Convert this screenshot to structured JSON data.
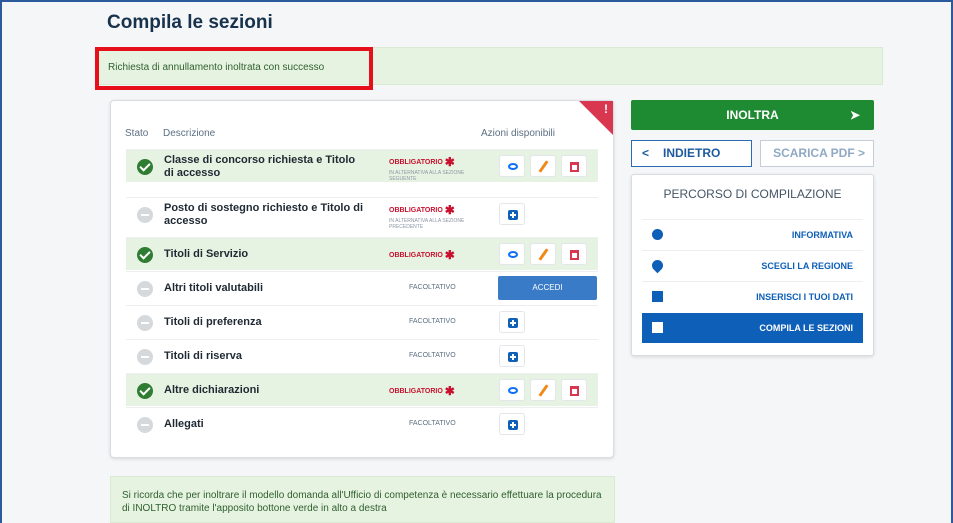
{
  "page": {
    "title": "Compila le sezioni"
  },
  "alert": {
    "success": "Richiesta di annullamento inoltrata con successo"
  },
  "table": {
    "headers": {
      "stato": "Stato",
      "descrizione": "Descrizione",
      "azioni": "Azioni disponibili"
    },
    "corner_mark": "!",
    "rows": [
      {
        "title": "Classe di concorso richiesta e Titolo di accesso",
        "status": "completed",
        "requirement": "OBBLIGATORIO",
        "note": "IN ALTERNATIVA ALLA SEZIONE SEGUENTE",
        "actions": [
          "view",
          "edit",
          "delete"
        ]
      },
      {
        "title": "Posto di sostegno richiesto e Titolo di accesso",
        "status": "empty",
        "requirement": "OBBLIGATORIO",
        "note": "IN ALTERNATIVA ALLA SEZIONE PRECEDENTE",
        "actions": [
          "add"
        ]
      },
      {
        "title": "Titoli di Servizio",
        "status": "completed",
        "requirement": "OBBLIGATORIO",
        "actions": [
          "view",
          "edit",
          "delete"
        ]
      },
      {
        "title": "Altri titoli valutabili",
        "status": "empty",
        "requirement": "FACOLTATIVO",
        "actions": [
          "accedi"
        ],
        "accedi_label": "ACCEDI"
      },
      {
        "title": "Titoli di preferenza",
        "status": "empty",
        "requirement": "FACOLTATIVO",
        "actions": [
          "add"
        ]
      },
      {
        "title": "Titoli di riserva",
        "status": "empty",
        "requirement": "FACOLTATIVO",
        "actions": [
          "add"
        ]
      },
      {
        "title": "Altre dichiarazioni",
        "status": "completed",
        "requirement": "OBBLIGATORIO",
        "actions": [
          "view",
          "edit",
          "delete"
        ]
      },
      {
        "title": "Allegati",
        "status": "empty",
        "requirement": "FACOLTATIVO",
        "actions": [
          "add"
        ]
      }
    ]
  },
  "sidebar": {
    "inoltra_label": "INOLTRA",
    "indietro_label": "INDIETRO",
    "indietro_chev": "<",
    "pdf_label": "SCARICA PDF >",
    "percorso_title": "PERCORSO DI COMPILAZIONE",
    "items": [
      {
        "label": "INFORMATIVA",
        "icon": "info-icon"
      },
      {
        "label": "SCEGLI LA REGIONE",
        "icon": "location-pin-icon"
      },
      {
        "label": "INSERISCI I TUOI DATI",
        "icon": "id-card-icon"
      },
      {
        "label": "COMPILA LE SEZIONI",
        "icon": "briefcase-icon",
        "active": true
      }
    ]
  },
  "footer": {
    "note": "Si ricorda che per inoltrare il modello domanda all'Ufficio di competenza è necessario effettuare la procedura di INOLTRO tramite l'apposito bottone verde in alto a destra"
  },
  "colors": {
    "success_bg": "#e6f3e0",
    "primary": "#0d5fb8",
    "green_button": "#1e8a31",
    "danger": "#d9364f",
    "highlight": "#e5101a"
  }
}
